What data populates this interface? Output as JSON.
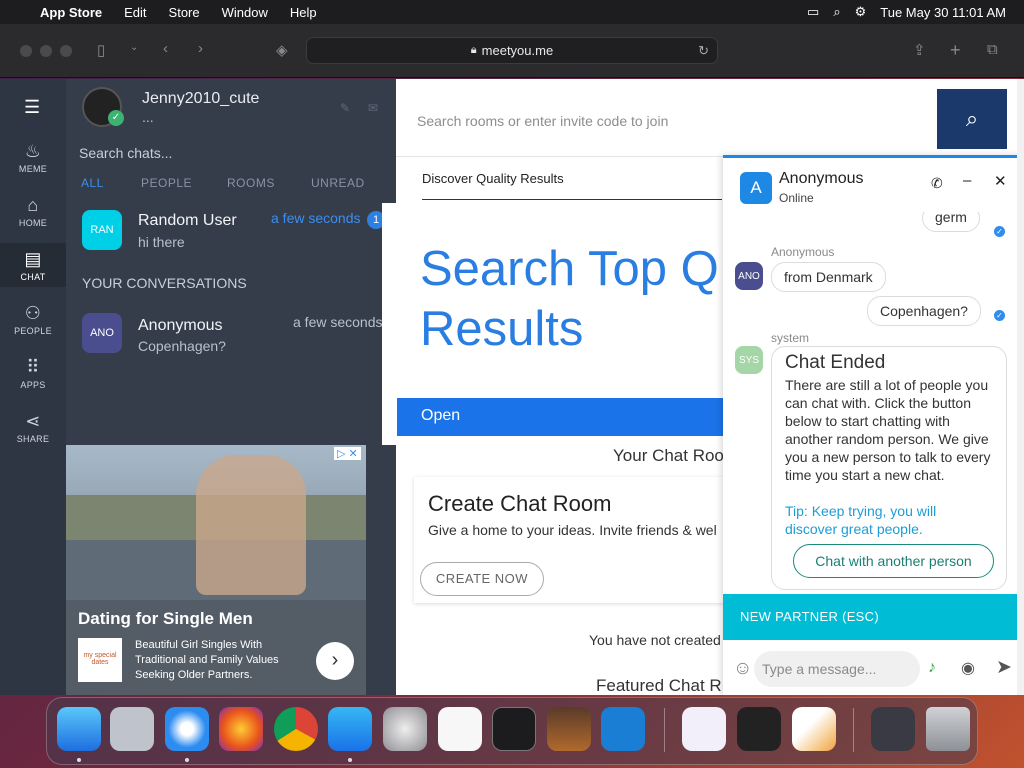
{
  "menubar": {
    "app": "App Store",
    "items": [
      "Edit",
      "Store",
      "Window",
      "Help"
    ],
    "clock": "Tue May 30  11:01 AM"
  },
  "browser": {
    "url": "meetyou.me"
  },
  "nav": [
    {
      "label": "MEME",
      "icon": "flame-icon"
    },
    {
      "label": "HOME",
      "icon": "home-icon"
    },
    {
      "label": "CHAT",
      "icon": "chat-icon"
    },
    {
      "label": "PEOPLE",
      "icon": "people-icon"
    },
    {
      "label": "APPS",
      "icon": "apps-icon"
    },
    {
      "label": "SHARE",
      "icon": "share-icon"
    }
  ],
  "profile": {
    "username": "Jenny2010_cute",
    "status": "..."
  },
  "chatsearch": {
    "placeholder": "Search chats..."
  },
  "filters": [
    "ALL",
    "PEOPLE",
    "ROOMS",
    "UNREAD"
  ],
  "random_chat": {
    "avatar": "RAN",
    "name": "Random User",
    "last": "hi there",
    "time": "a few seconds",
    "badge": "1"
  },
  "section_title": "YOUR CONVERSATIONS",
  "conversations": [
    {
      "avatar": "ANO",
      "name": "Anonymous",
      "last": "Copenhagen?",
      "time": "a few seconds"
    }
  ],
  "ad": {
    "title": "Dating for Single Men",
    "logo_text": "my special dates",
    "body": "Beautiful Girl Singles With Traditional and Family Values Seeking Older Partners."
  },
  "main": {
    "search_placeholder": "Search rooms or enter invite code to join",
    "tab": "Discover Quality Results",
    "hero_line1": "Search Top Q",
    "hero_line2": "Results",
    "open_label": "Open",
    "your_rooms": "Your Chat Roo",
    "create_title": "Create Chat Room",
    "create_desc": "Give a home to your ideas. Invite friends & wel",
    "create_btn": "CREATE NOW",
    "none_created": "You have not created",
    "featured": "Featured Chat R"
  },
  "chat": {
    "partner_avatar": "A",
    "partner": "Anonymous",
    "status": "Online",
    "msg_germ": "germ",
    "sender_anon": "Anonymous",
    "anon_avatar": "ANO",
    "msg_denmark": "from Denmark",
    "msg_copenhagen": "Copenhagen?",
    "sender_system": "system",
    "sys_avatar": "SYS",
    "ended_title": "Chat Ended",
    "ended_body": "There are still a lot of people you can chat with. Click the button below to start chatting with another random person. We give you a new person to talk to every time you start a new chat.",
    "ended_tip": "Tip: Keep trying, you will discover great people.",
    "another_btn": "Chat with another person",
    "new_partner": "NEW PARTNER (ESC)",
    "input_placeholder": "Type a message..."
  },
  "colors": {
    "accent": "#1e88e5",
    "nav_bg": "#2f3643",
    "list_bg": "#353d4b",
    "teal": "#00bcd4"
  }
}
